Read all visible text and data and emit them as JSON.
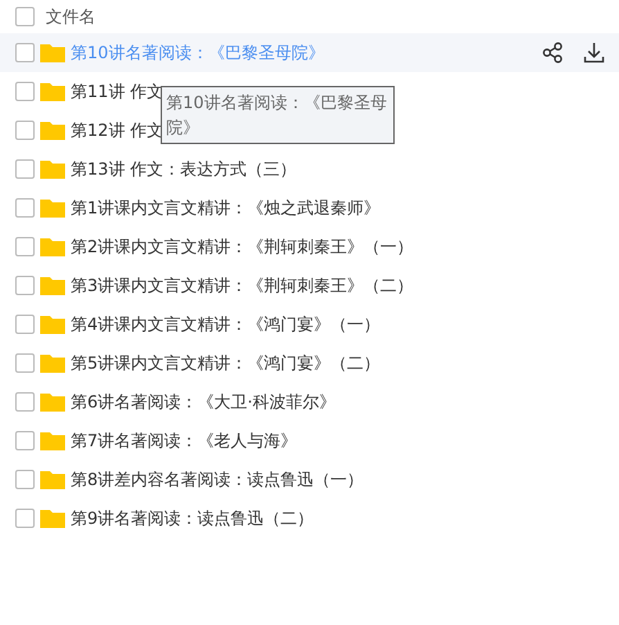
{
  "header": {
    "checked": false,
    "label": "文件名"
  },
  "rows": [
    {
      "name": "第10讲名著阅读：《巴黎圣母院》",
      "hovered": true,
      "checked": false
    },
    {
      "name": "第11讲 作文",
      "hovered": false,
      "checked": false
    },
    {
      "name": "第12讲 作文",
      "hovered": false,
      "checked": false
    },
    {
      "name": "第13讲 作文：表达方式（三）",
      "hovered": false,
      "checked": false
    },
    {
      "name": "第1讲课内文言文精讲：《烛之武退秦师》",
      "hovered": false,
      "checked": false
    },
    {
      "name": "第2讲课内文言文精讲：《荆轲刺秦王》（一）",
      "hovered": false,
      "checked": false
    },
    {
      "name": "第3讲课内文言文精讲：《荆轲刺秦王》（二）",
      "hovered": false,
      "checked": false
    },
    {
      "name": "第4讲课内文言文精讲：《鸿门宴》（一）",
      "hovered": false,
      "checked": false
    },
    {
      "name": "第5讲课内文言文精讲：《鸿门宴》（二）",
      "hovered": false,
      "checked": false
    },
    {
      "name": "第6讲名著阅读：《大卫·科波菲尔》",
      "hovered": false,
      "checked": false
    },
    {
      "name": "第7讲名著阅读：《老人与海》",
      "hovered": false,
      "checked": false
    },
    {
      "name": "第8讲差内容名著阅读：读点鲁迅（一）",
      "hovered": false,
      "checked": false
    },
    {
      "name": "第9讲名著阅读：读点鲁迅（二）",
      "hovered": false,
      "checked": false
    }
  ],
  "tooltip": {
    "text": "第10讲名著阅读：《巴黎圣母院》"
  }
}
